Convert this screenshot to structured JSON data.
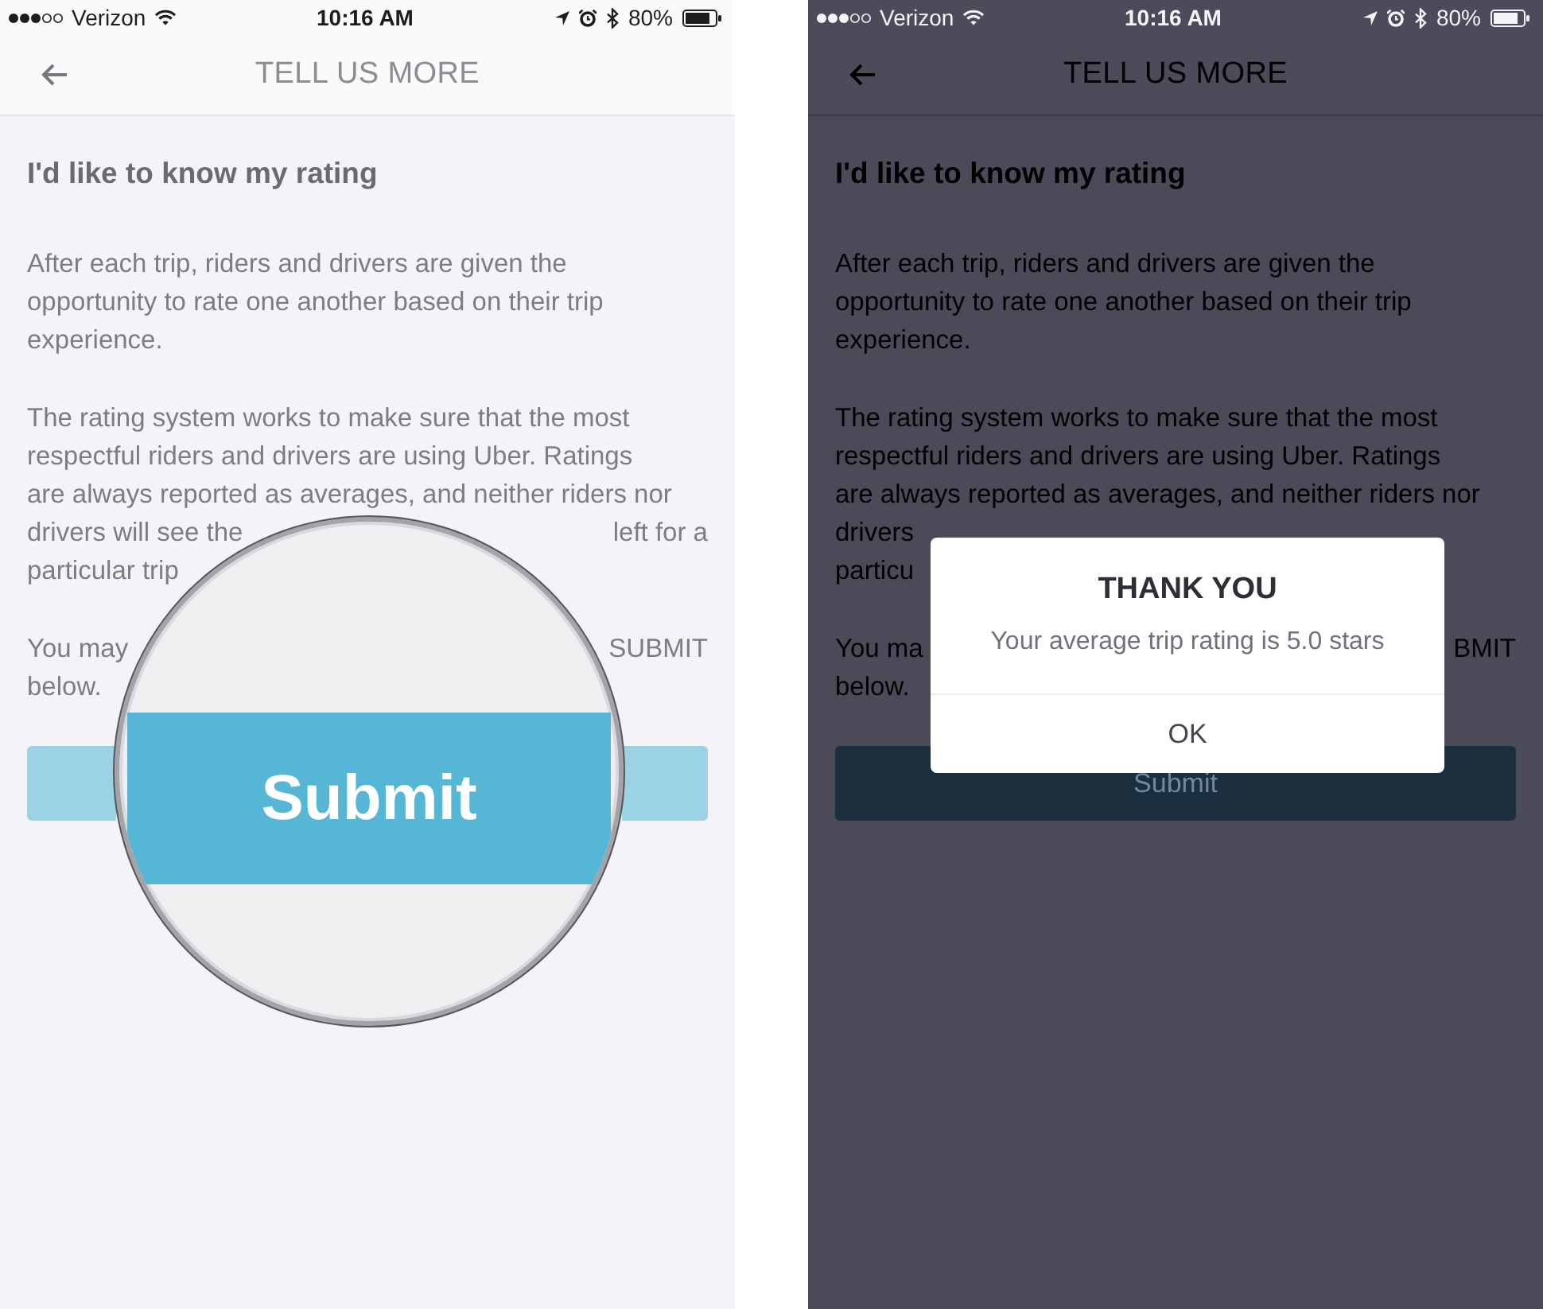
{
  "screens": [
    {
      "dimmed": false,
      "status_bar": {
        "carrier": "Verizon",
        "time": "10:16 AM",
        "battery": "80%"
      },
      "nav_bar": {
        "title": "TELL US MORE"
      },
      "heading": "I'd like to know my rating",
      "paragraphs": [
        [
          [
            "After each trip, riders and drivers are given the\nopportunity to rate one another based on their trip\nexperience."
          ]
        ],
        [
          [
            "The rating system works to make sure that the most\nrespectful riders and drivers are using Uber. Ratings\nare always reported as averages, and neither riders nor"
          ],
          [
            "drivers will see the",
            "left for a"
          ],
          [
            "particular trip"
          ]
        ],
        [
          [
            "You may",
            "SUBMIT"
          ],
          [
            "below."
          ]
        ]
      ],
      "magnifier": {
        "label": "Submit"
      }
    },
    {
      "dimmed": true,
      "status_bar": {
        "carrier": "Verizon",
        "time": "10:16 AM",
        "battery": "80%"
      },
      "nav_bar": {
        "title": "TELL US MORE"
      },
      "heading": "I'd like to know my rating",
      "paragraphs": [
        [
          [
            "After each trip, riders and drivers are given the\nopportunity to rate one another based on their trip\nexperience."
          ]
        ],
        [
          [
            "The rating system works to make sure that the most\nrespectful riders and drivers are using Uber. Ratings\nare always reported as averages, and neither riders nor"
          ],
          [
            "drivers"
          ],
          [
            "particu"
          ]
        ],
        [
          [
            "You ma",
            "BMIT"
          ],
          [
            "below."
          ]
        ]
      ],
      "submit_button": {
        "label": "Submit"
      },
      "dialog": {
        "title": "THANK YOU",
        "message": "Your average trip rating is 5.0 stars",
        "button": "OK"
      }
    }
  ]
}
